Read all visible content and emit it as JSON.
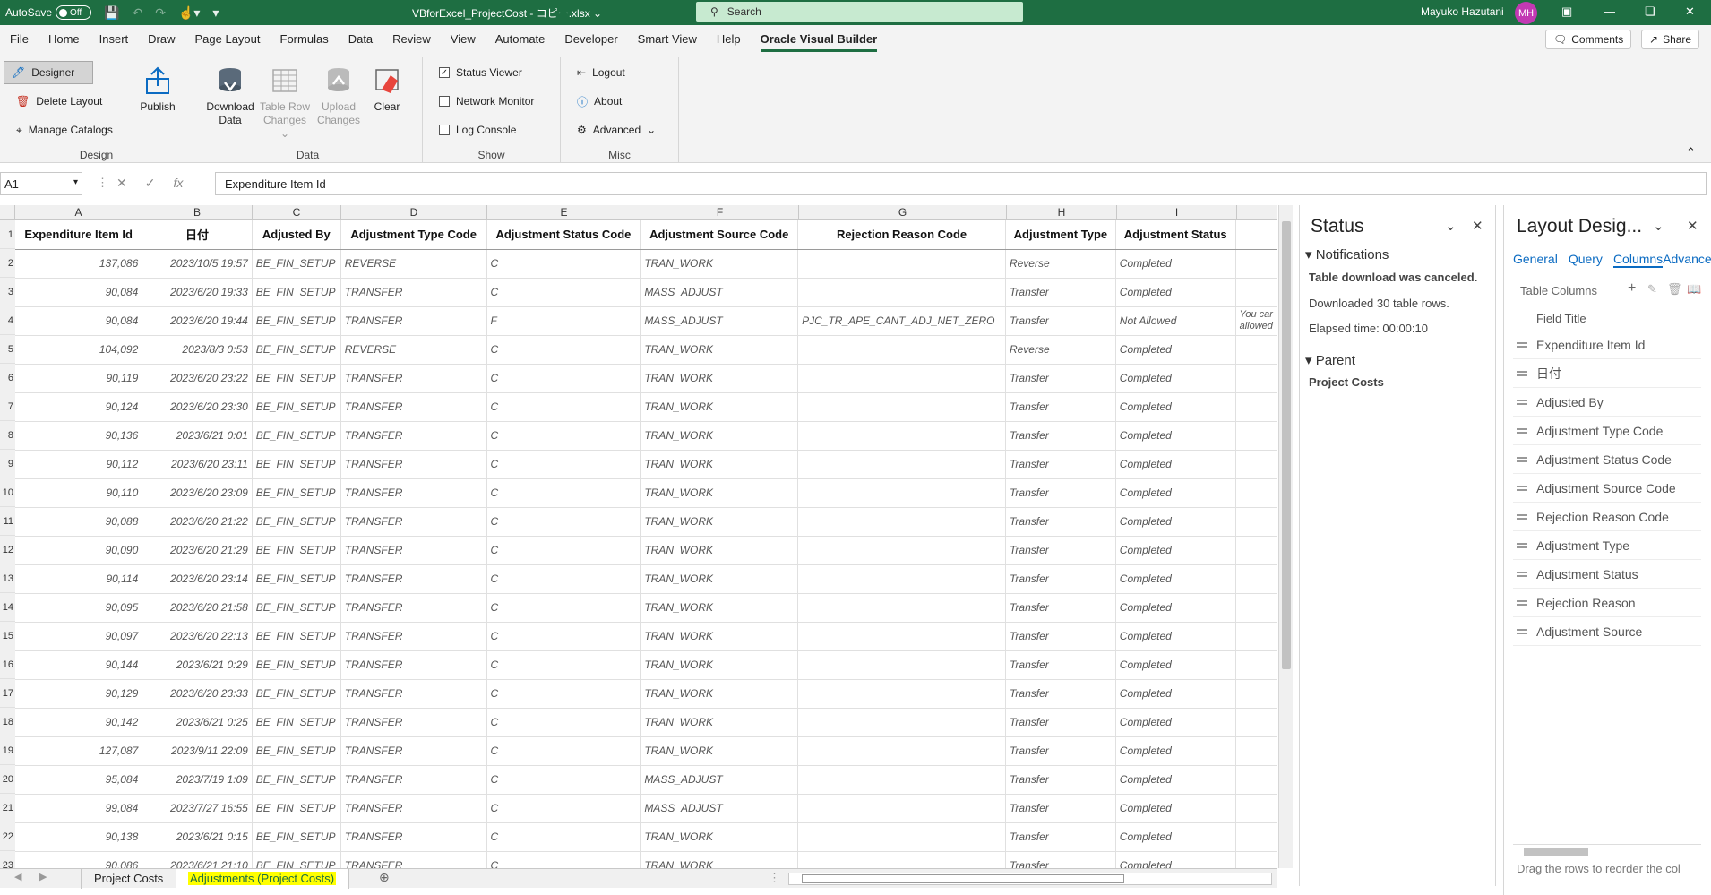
{
  "titlebar": {
    "autosave_label": "AutoSave",
    "autosave_state": "Off",
    "document_title": "VBforExcel_ProjectCost - コピー.xlsx",
    "search_placeholder": "Search",
    "user_name": "Mayuko Hazutani",
    "user_initials": "MH"
  },
  "menu": {
    "tabs": [
      "File",
      "Home",
      "Insert",
      "Draw",
      "Page Layout",
      "Formulas",
      "Data",
      "Review",
      "View",
      "Automate",
      "Developer",
      "Smart View",
      "Help",
      "Oracle Visual Builder"
    ],
    "comments_label": "Comments",
    "share_label": "Share"
  },
  "ribbon": {
    "design": {
      "label": "Design",
      "designer": "Designer",
      "delete_layout": "Delete Layout",
      "manage_catalogs": "Manage Catalogs",
      "publish": "Publish"
    },
    "data": {
      "label": "Data",
      "download_l1": "Download",
      "download_l2": "Data",
      "table_row_l1": "Table Row",
      "table_row_l2": "Changes",
      "upload_l1": "Upload",
      "upload_l2": "Changes",
      "clear": "Clear"
    },
    "show": {
      "label": "Show",
      "status_viewer": "Status Viewer",
      "network_monitor": "Network Monitor",
      "log_console": "Log Console"
    },
    "misc": {
      "label": "Misc",
      "logout": "Logout",
      "about": "About",
      "advanced": "Advanced"
    }
  },
  "formula_bar": {
    "cell_ref": "A1",
    "content": "Expenditure Item Id"
  },
  "sheet": {
    "col_letters": [
      "A",
      "B",
      "C",
      "D",
      "E",
      "F",
      "G",
      "H",
      "I",
      ""
    ],
    "headers": [
      "Expenditure Item Id",
      "日付",
      "Adjusted By",
      "Adjustment Type Code",
      "Adjustment Status Code",
      "Adjustment Source Code",
      "Rejection Reason Code",
      "Adjustment Type",
      "Adjustment Status",
      ""
    ],
    "row_numbers": [
      "1",
      "2",
      "3",
      "4",
      "5",
      "6",
      "7",
      "8",
      "9",
      "10",
      "11",
      "12",
      "13",
      "14",
      "15",
      "16",
      "17",
      "18",
      "19",
      "20",
      "21",
      "22",
      "23"
    ],
    "rows": [
      [
        "137,086",
        "2023/10/5 19:57",
        "BE_FIN_SETUP",
        "REVERSE",
        "C",
        "TRAN_WORK",
        "",
        "Reverse",
        "Completed",
        ""
      ],
      [
        "90,084",
        "2023/6/20 19:33",
        "BE_FIN_SETUP",
        "TRANSFER",
        "C",
        "MASS_ADJUST",
        "",
        "Transfer",
        "Completed",
        ""
      ],
      [
        "90,084",
        "2023/6/20 19:44",
        "BE_FIN_SETUP",
        "TRANSFER",
        "F",
        "MASS_ADJUST",
        "PJC_TR_APE_CANT_ADJ_NET_ZERO",
        "Transfer",
        "Not Allowed",
        "You car allowed"
      ],
      [
        "104,092",
        "2023/8/3 0:53",
        "BE_FIN_SETUP",
        "REVERSE",
        "C",
        "TRAN_WORK",
        "",
        "Reverse",
        "Completed",
        ""
      ],
      [
        "90,119",
        "2023/6/20 23:22",
        "BE_FIN_SETUP",
        "TRANSFER",
        "C",
        "TRAN_WORK",
        "",
        "Transfer",
        "Completed",
        ""
      ],
      [
        "90,124",
        "2023/6/20 23:30",
        "BE_FIN_SETUP",
        "TRANSFER",
        "C",
        "TRAN_WORK",
        "",
        "Transfer",
        "Completed",
        ""
      ],
      [
        "90,136",
        "2023/6/21 0:01",
        "BE_FIN_SETUP",
        "TRANSFER",
        "C",
        "TRAN_WORK",
        "",
        "Transfer",
        "Completed",
        ""
      ],
      [
        "90,112",
        "2023/6/20 23:11",
        "BE_FIN_SETUP",
        "TRANSFER",
        "C",
        "TRAN_WORK",
        "",
        "Transfer",
        "Completed",
        ""
      ],
      [
        "90,110",
        "2023/6/20 23:09",
        "BE_FIN_SETUP",
        "TRANSFER",
        "C",
        "TRAN_WORK",
        "",
        "Transfer",
        "Completed",
        ""
      ],
      [
        "90,088",
        "2023/6/20 21:22",
        "BE_FIN_SETUP",
        "TRANSFER",
        "C",
        "TRAN_WORK",
        "",
        "Transfer",
        "Completed",
        ""
      ],
      [
        "90,090",
        "2023/6/20 21:29",
        "BE_FIN_SETUP",
        "TRANSFER",
        "C",
        "TRAN_WORK",
        "",
        "Transfer",
        "Completed",
        ""
      ],
      [
        "90,114",
        "2023/6/20 23:14",
        "BE_FIN_SETUP",
        "TRANSFER",
        "C",
        "TRAN_WORK",
        "",
        "Transfer",
        "Completed",
        ""
      ],
      [
        "90,095",
        "2023/6/20 21:58",
        "BE_FIN_SETUP",
        "TRANSFER",
        "C",
        "TRAN_WORK",
        "",
        "Transfer",
        "Completed",
        ""
      ],
      [
        "90,097",
        "2023/6/20 22:13",
        "BE_FIN_SETUP",
        "TRANSFER",
        "C",
        "TRAN_WORK",
        "",
        "Transfer",
        "Completed",
        ""
      ],
      [
        "90,144",
        "2023/6/21 0:29",
        "BE_FIN_SETUP",
        "TRANSFER",
        "C",
        "TRAN_WORK",
        "",
        "Transfer",
        "Completed",
        ""
      ],
      [
        "90,129",
        "2023/6/20 23:33",
        "BE_FIN_SETUP",
        "TRANSFER",
        "C",
        "TRAN_WORK",
        "",
        "Transfer",
        "Completed",
        ""
      ],
      [
        "90,142",
        "2023/6/21 0:25",
        "BE_FIN_SETUP",
        "TRANSFER",
        "C",
        "TRAN_WORK",
        "",
        "Transfer",
        "Completed",
        ""
      ],
      [
        "127,087",
        "2023/9/11 22:09",
        "BE_FIN_SETUP",
        "TRANSFER",
        "C",
        "TRAN_WORK",
        "",
        "Transfer",
        "Completed",
        ""
      ],
      [
        "95,084",
        "2023/7/19 1:09",
        "BE_FIN_SETUP",
        "TRANSFER",
        "C",
        "MASS_ADJUST",
        "",
        "Transfer",
        "Completed",
        ""
      ],
      [
        "99,084",
        "2023/7/27 16:55",
        "BE_FIN_SETUP",
        "TRANSFER",
        "C",
        "MASS_ADJUST",
        "",
        "Transfer",
        "Completed",
        ""
      ],
      [
        "90,138",
        "2023/6/21 0:15",
        "BE_FIN_SETUP",
        "TRANSFER",
        "C",
        "TRAN_WORK",
        "",
        "Transfer",
        "Completed",
        ""
      ],
      [
        "90,086",
        "2023/6/21 21:10",
        "BE_FIN_SETUP",
        "TRANSFER",
        "C",
        "TRAN_WORK",
        "",
        "Transfer",
        "Completed",
        ""
      ]
    ],
    "tabs": [
      "Project Costs",
      "Adjustments (Project Costs)"
    ]
  },
  "status_pane": {
    "title": "Status",
    "notifications_title": "Notifications",
    "message_bold": "Table download was canceled.",
    "message_rows": "Downloaded 30 table rows.",
    "message_elapsed": "Elapsed time: 00:00:10",
    "parent_title": "Parent",
    "parent_value": "Project Costs"
  },
  "layout_pane": {
    "title": "Layout Desig...",
    "tabs": [
      "General",
      "Query",
      "Columns",
      "Advance"
    ],
    "table_columns_label": "Table Columns",
    "field_title_label": "Field Title",
    "fields": [
      "Expenditure Item Id",
      "日付",
      "Adjusted By",
      "Adjustment Type Code",
      "Adjustment Status Code",
      "Adjustment Source Code",
      "Rejection Reason Code",
      "Adjustment Type",
      "Adjustment Status",
      "Rejection Reason",
      "Adjustment Source"
    ],
    "footer_hint": "Drag the rows to reorder the col"
  },
  "colors": {
    "excel_green": "#1e6e42",
    "link_blue": "#0b6bc2",
    "highlight_yellow": "#ffff00"
  }
}
